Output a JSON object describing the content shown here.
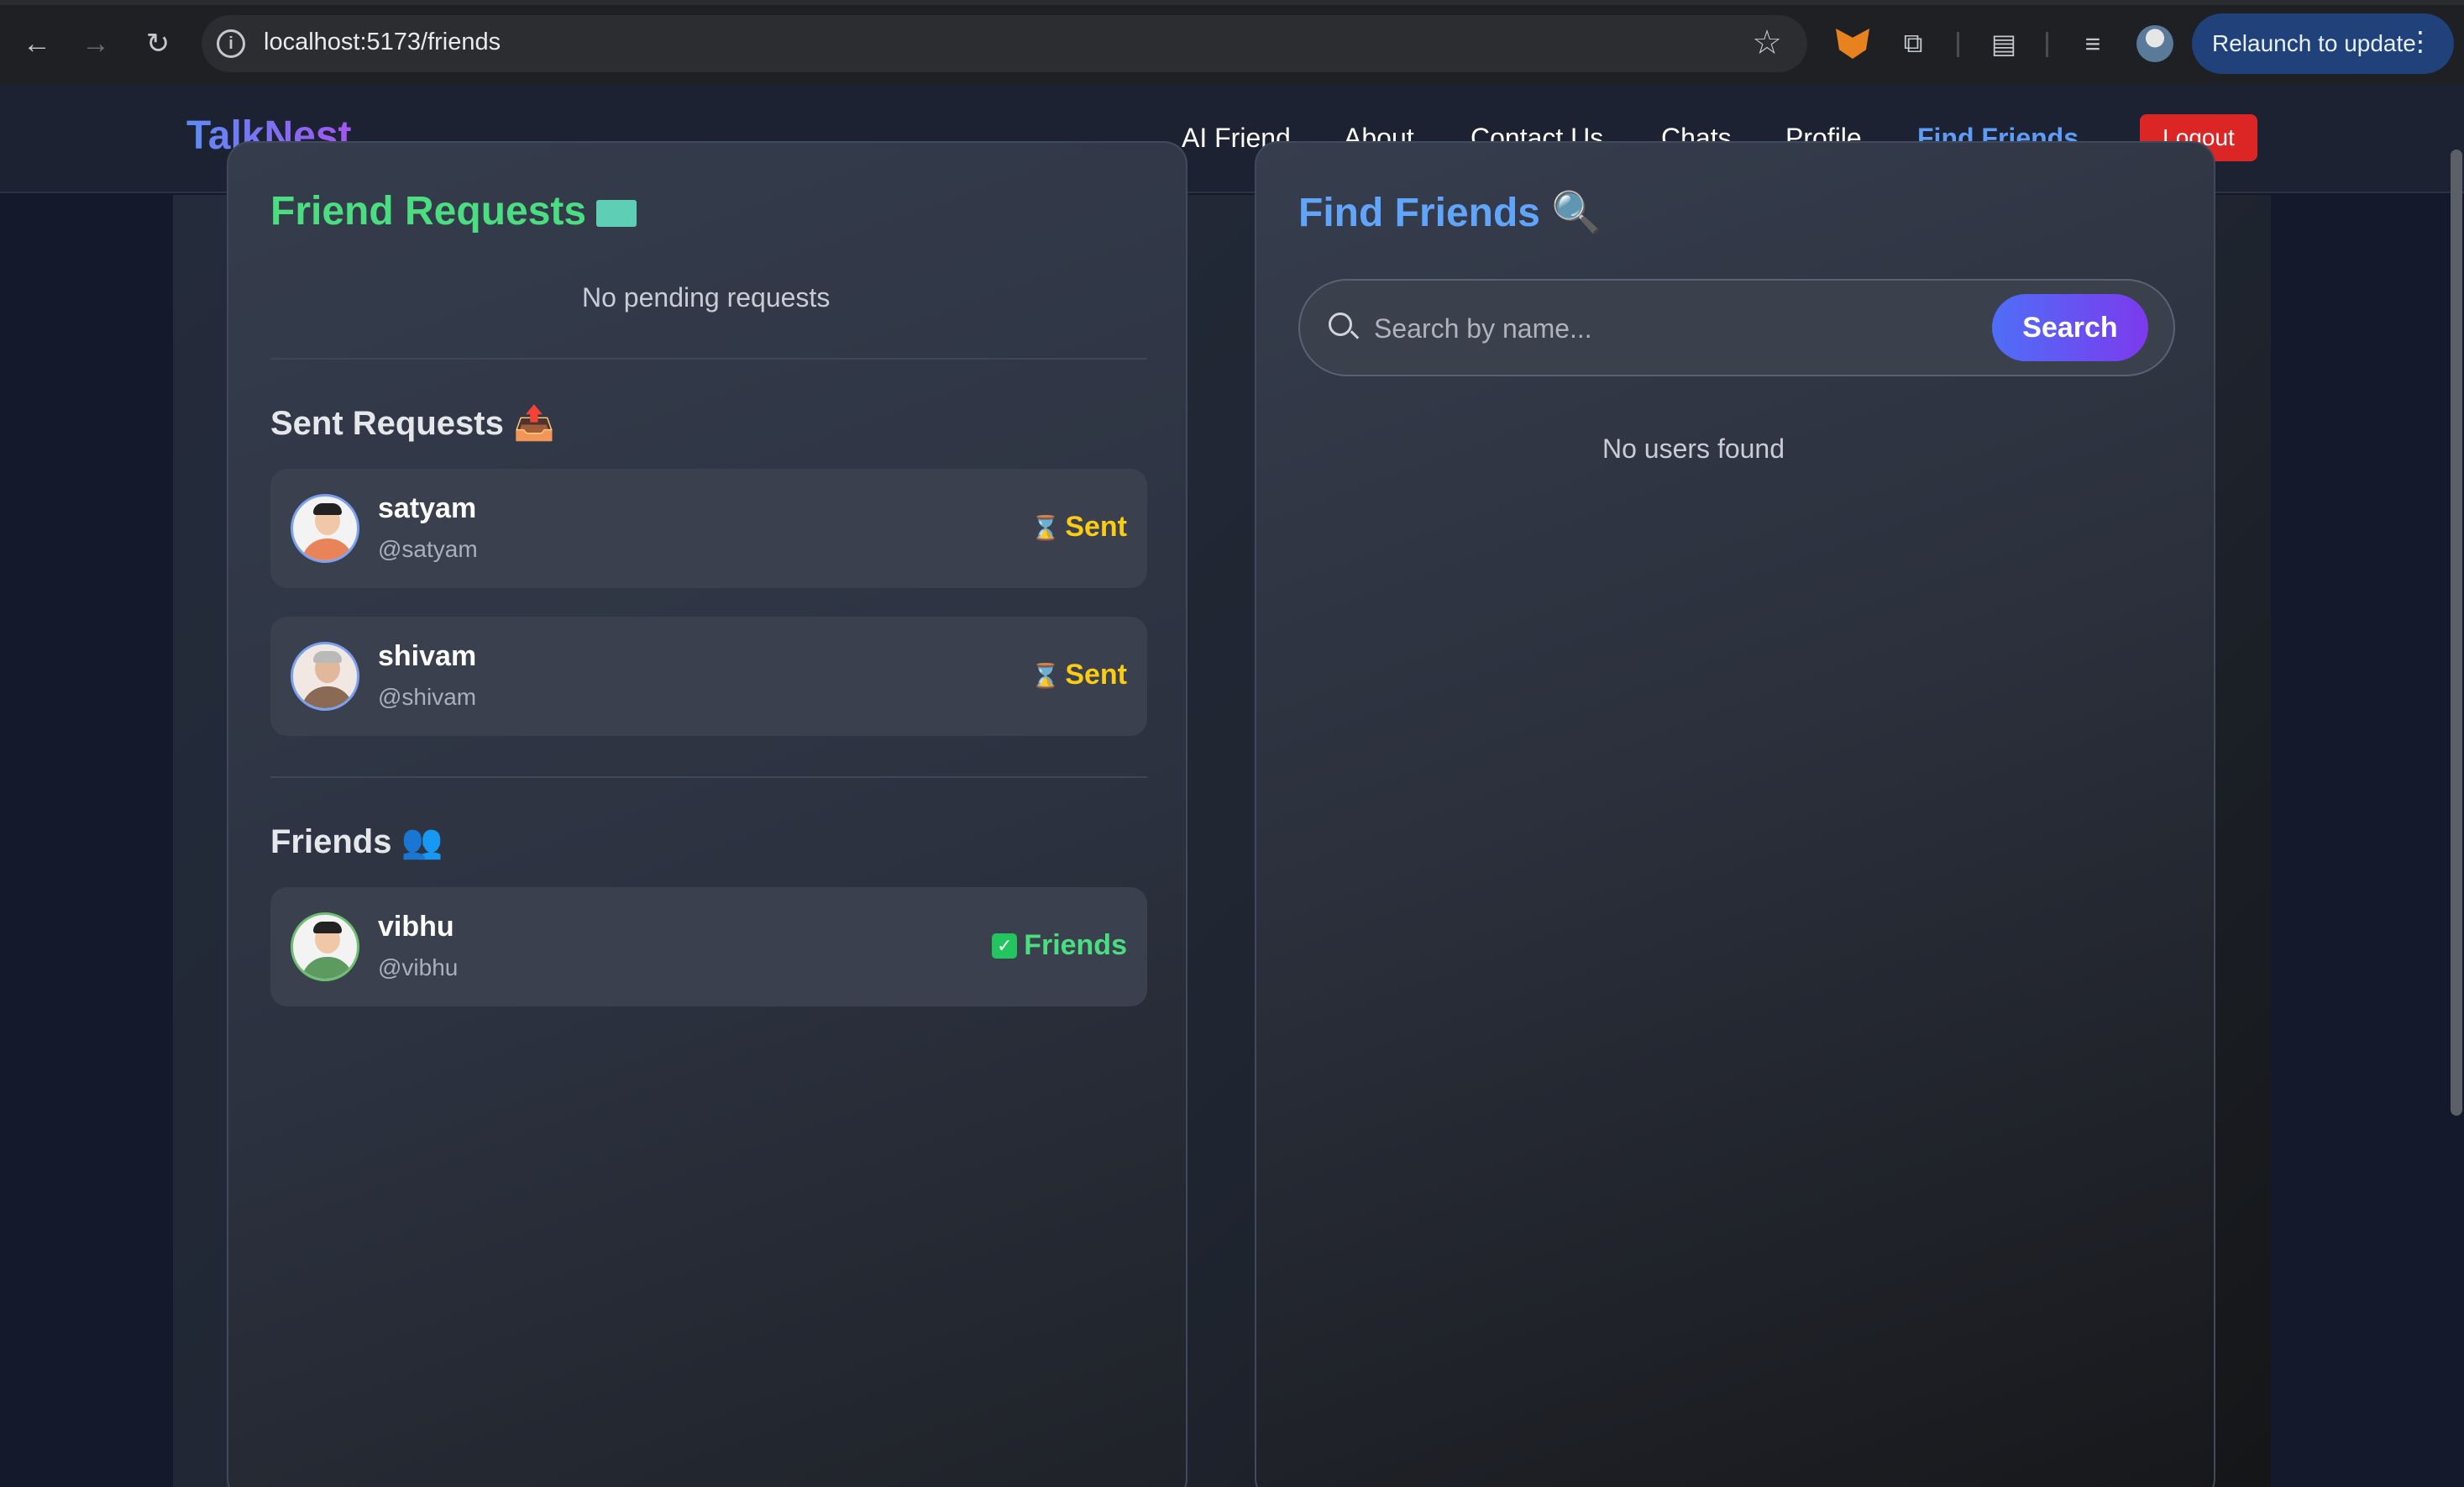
{
  "browser": {
    "url": "localhost:5173/friends",
    "relaunch_label": "Relaunch to update"
  },
  "app": {
    "logo": "TalkNest",
    "nav": [
      "AI Friend",
      "About",
      "Contact Us",
      "Chats",
      "Profile",
      "Find Friends"
    ],
    "active_nav": "Find Friends",
    "logout_label": "Logout"
  },
  "friend_requests": {
    "title": "Friend Requests",
    "empty_text": "No pending requests"
  },
  "sent_requests": {
    "title": "Sent Requests 📤",
    "items": [
      {
        "name": "satyam",
        "handle": "@satyam",
        "status": "Sent"
      },
      {
        "name": "shivam",
        "handle": "@shivam",
        "status": "Sent"
      }
    ]
  },
  "friends": {
    "title": "Friends 👥",
    "items": [
      {
        "name": "vibhu",
        "handle": "@vibhu",
        "status": "Friends"
      }
    ]
  },
  "find_friends": {
    "title": "Find Friends 🔍",
    "search_placeholder": "Search by name...",
    "search_button": "Search",
    "empty_text": "No users found"
  },
  "colors": {
    "accent_blue": "#60a5fa",
    "accent_green": "#4ade80",
    "sent_yellow": "#facc15",
    "logout_red": "#dc2626"
  }
}
